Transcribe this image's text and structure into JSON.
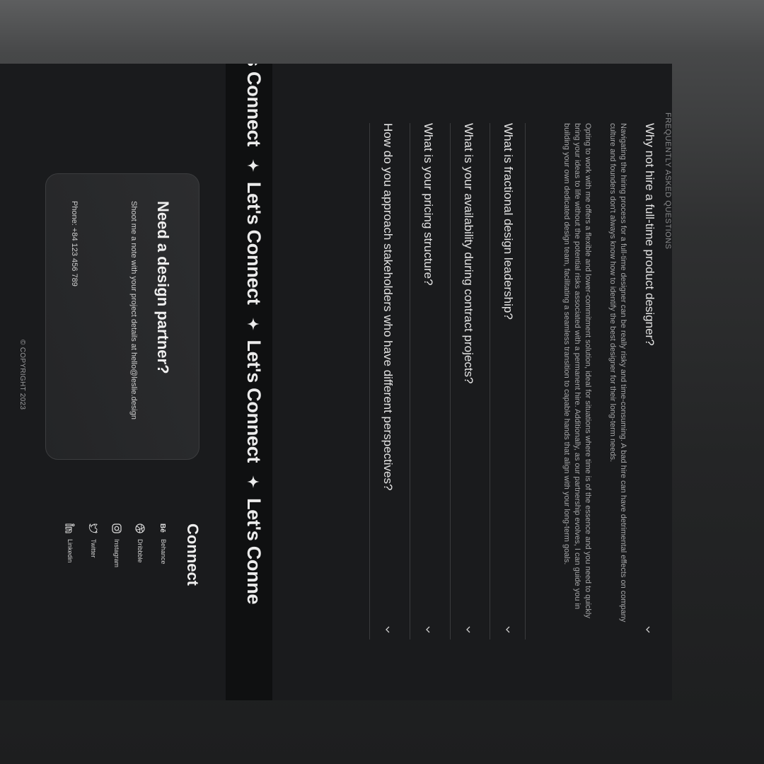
{
  "faq": {
    "label": "FREQUENTLY ASKED QUESTIONS",
    "items": [
      {
        "question": "Why not hire a full-time product designer?",
        "answer_p1": "Navigating the hiring process for a full-time designer can be really risky and time-consuming. A bad hire can have detrimental effects on company culture and founders don't always know how to identify the best designer for their long-term needs.",
        "answer_p2": "Opting to work with me offers a flexible and lower-commitment solution, ideal for situations where time is of the essence and you need to quickly bring your ideas to life without the potential risks associated with a permanent hire. Additionally, as our partnership evolves, I can guide you in building your own dedicated design team, facilitating a seamless transition to capable hands that align with your long-term goals."
      },
      {
        "question": "What is fractional design leadership?"
      },
      {
        "question": "What is your availability during contract projects?"
      },
      {
        "question": "What is your pricing structure?"
      },
      {
        "question": "How do you approach stakeholders who have different perspectives?"
      }
    ]
  },
  "ticker": {
    "label": "Let's Connect",
    "partial_end": "Let's Conne",
    "partial_start": "ct"
  },
  "footer": {
    "card": {
      "title": "Need a design partner?",
      "note": "Shoot me a note with your project details at hello@leslie.design",
      "phone": "Phone: +84 123 456 789"
    },
    "connect": {
      "title": "Connect",
      "links": [
        {
          "label": "Behance",
          "icon": "behance-icon"
        },
        {
          "label": "Dribbble",
          "icon": "dribbble-icon"
        },
        {
          "label": "Instagram",
          "icon": "instagram-icon"
        },
        {
          "label": "Twitter",
          "icon": "twitter-icon"
        },
        {
          "label": "Linkedin",
          "icon": "linkedin-icon"
        }
      ]
    },
    "copyright": "© COPYRIGHT 2023"
  },
  "colors": {
    "background": "#1a1b1d",
    "ticker_band": "#0f1011",
    "card": "#2c2d2f",
    "text": "#e4e4e4"
  }
}
